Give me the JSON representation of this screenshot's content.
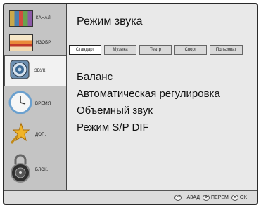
{
  "sidebar": {
    "items": [
      {
        "label": "КАНАЛ",
        "icon": "channel-icon"
      },
      {
        "label": "ИЗОБР",
        "icon": "picture-icon"
      },
      {
        "label": "ЗВУК",
        "icon": "speaker-icon",
        "active": true
      },
      {
        "label": "ВРЕМЯ",
        "icon": "clock-icon"
      },
      {
        "label": "ДОП.",
        "icon": "star-icon"
      },
      {
        "label": "БЛОК.",
        "icon": "lock-icon"
      }
    ]
  },
  "main": {
    "title": "Режим звука",
    "tabs": [
      {
        "label": "Стандарт",
        "active": true
      },
      {
        "label": "Музыка"
      },
      {
        "label": "Театр"
      },
      {
        "label": "Спорт"
      },
      {
        "label": "Пользоват"
      }
    ],
    "menu": [
      "Баланс",
      "Автоматическая регулировка",
      "Объемный звук",
      "Режим S/P DIF"
    ]
  },
  "footer": {
    "hints": [
      {
        "icon": "back-icon",
        "label": "НАЗАД"
      },
      {
        "icon": "move-icon",
        "label": "ПЕРЕМ"
      },
      {
        "icon": "ok-icon",
        "label": "OK"
      }
    ]
  }
}
